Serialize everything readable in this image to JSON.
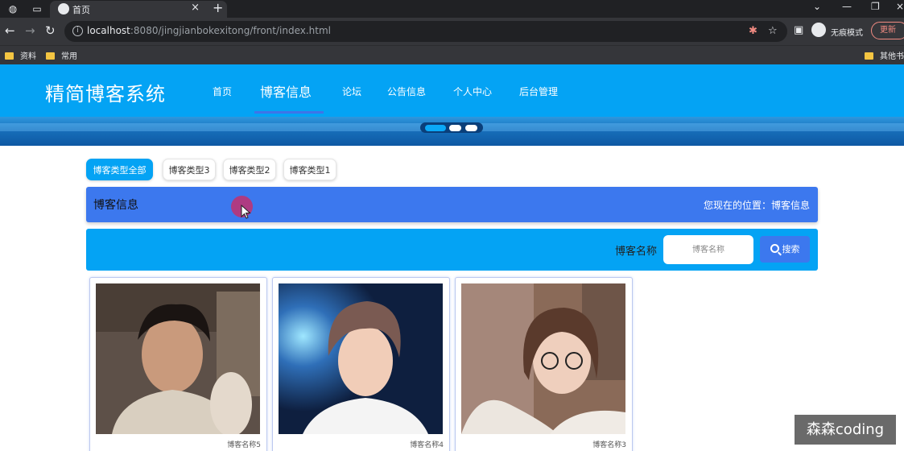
{
  "browser": {
    "tab_title": "首页",
    "url_host": "localhost",
    "url_rest": ":8080/jingjianbokexitong/front/index.html",
    "incognito_label": "无痕模式",
    "update_label": "更新",
    "bookmarks": [
      "资料",
      "常用"
    ],
    "other_bookmarks": "其他书"
  },
  "site": {
    "title": "精简博客系统",
    "nav": [
      "首页",
      "博客信息",
      "论坛",
      "公告信息",
      "个人中心",
      "后台管理"
    ],
    "active_nav": "博客信息"
  },
  "filters": [
    "博客类型全部",
    "博客类型3",
    "博客类型2",
    "博客类型1"
  ],
  "info_bar": {
    "title": "博客信息",
    "location": "您现在的位置：博客信息"
  },
  "search": {
    "label": "博客名称",
    "placeholder": "博客名称",
    "button": "搜索"
  },
  "cards": [
    {
      "name": "博客名称5"
    },
    {
      "name": "博客名称4"
    },
    {
      "name": "博客名称3"
    }
  ],
  "watermark": "森森coding",
  "colors": {
    "primary": "#04a3f4",
    "accent": "#3c78ee",
    "chrome_dark": "#202124",
    "chrome_mid": "#35363a"
  }
}
